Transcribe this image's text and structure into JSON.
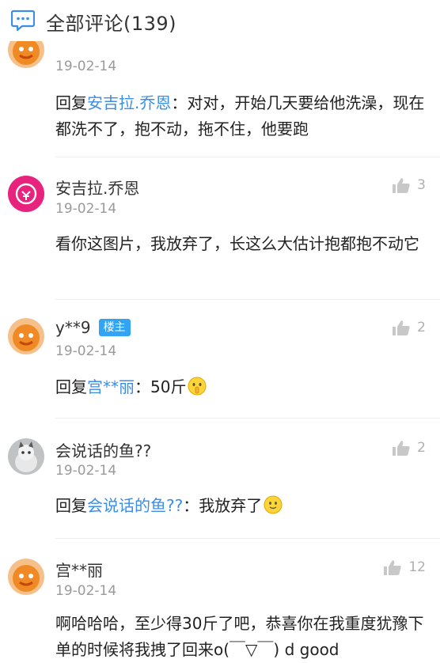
{
  "header": {
    "title": "全部评论(139)",
    "icon": "comment-bubble-icon"
  },
  "comments": [
    {
      "name": "",
      "date": "19-02-14",
      "reply_prefix": "回复",
      "reply_to": "安吉拉.乔恩",
      "text": "：对对，开始几天要给他洗澡，现在都洗不了，抱不动，拖不住，他要跑"
    },
    {
      "name": "安吉拉.乔恩",
      "date": "19-02-14",
      "likes": "3",
      "text": "看你这图片，我放弃了，长这么大估计抱都抱不动它"
    },
    {
      "name": "y**9",
      "badge": "楼主",
      "date": "19-02-14",
      "likes": "2",
      "reply_prefix": "回复",
      "reply_to": "宫**丽",
      "text": "：50斤"
    },
    {
      "name": "会说话的鱼??",
      "date": "19-02-14",
      "likes": "2",
      "reply_prefix": "回复",
      "reply_to": "会说话的鱼??",
      "text": "：我放弃了"
    },
    {
      "name": "宫**丽",
      "date": "19-02-14",
      "likes": "12",
      "text": "啊哈哈哈，至少得30斤了吧，恭喜你在我重度犹豫下单的时候将我拽了回来o(￣▽￣) d good"
    }
  ],
  "colors": {
    "mention": "#3a8ee6",
    "badge": "#33a3f4",
    "date": "#9a9a9a"
  }
}
